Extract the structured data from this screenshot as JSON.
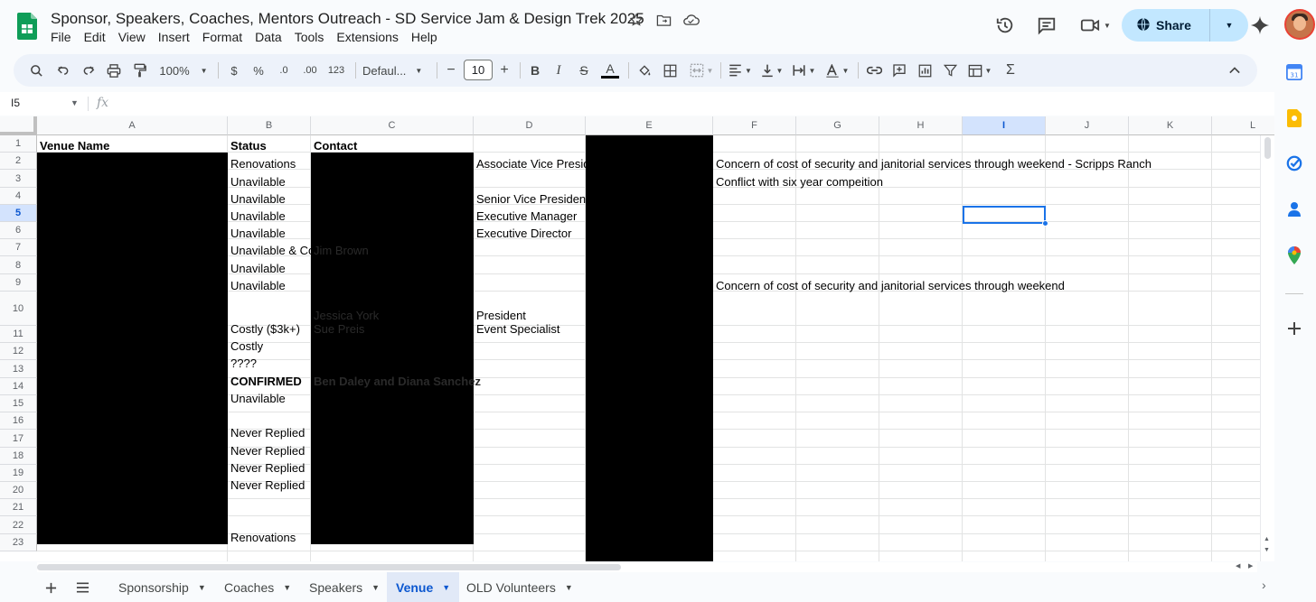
{
  "doc": {
    "title": "Sponsor, Speakers, Coaches, Mentors Outreach - SD Service Jam & Design Trek 2025"
  },
  "menu": [
    "File",
    "Edit",
    "View",
    "Insert",
    "Format",
    "Data",
    "Tools",
    "Extensions",
    "Help"
  ],
  "top_right": {
    "share_label": "Share",
    "icons": [
      "history-icon",
      "comment-icon",
      "video-call-icon",
      "gemini-icon"
    ]
  },
  "toolbar": {
    "zoom": "100%",
    "currency": "$",
    "percent": "%",
    "decrease_decimal": ".0",
    "increase_decimal": ".00",
    "number_format": "123",
    "font": "Defaul...",
    "font_size": "10",
    "minus": "−",
    "plus": "+",
    "bold": "B",
    "italic": "I",
    "strike": "S",
    "text_color": "A",
    "sigma": "Σ"
  },
  "formula": {
    "cell_ref": "I5",
    "fx": "fx"
  },
  "columns": [
    "A",
    "B",
    "C",
    "D",
    "E",
    "F",
    "G",
    "H",
    "I",
    "J",
    "K",
    "L"
  ],
  "selected_column": "I",
  "rows": [
    "1",
    "2",
    "3",
    "4",
    "5",
    "6",
    "7",
    "8",
    "9",
    "10",
    "11",
    "12",
    "13",
    "14",
    "15",
    "16",
    "17",
    "18",
    "19",
    "20",
    "21",
    "22",
    "23"
  ],
  "selected_row": "5",
  "cells": {
    "a1": "Venue Name",
    "b1": "Status",
    "c1": "Contact",
    "b2": "Renovations",
    "d2": "Associate Vice Preside",
    "f2": "Concern of cost of security and janitorial services through weekend - Scripps Ranch",
    "b3": "Unavilable",
    "f3": "Conflict with six year compeition",
    "b4": "Unavilable",
    "d4": "Senior Vice President",
    "b5": "Unavilable",
    "d5": "Executive Manager",
    "b6": "Unavilable",
    "d6": "Executive Director",
    "b7": "Unavilable & Co",
    "c7": "Jim Brown",
    "b8": "Unavilable",
    "b9": "Unavilable",
    "f9": "Concern of cost of security and janitorial services through weekend",
    "c10": "Jessica York\nSue Preis",
    "b10": "Costly ($3k+)",
    "d10": "President\nEvent Specialist",
    "b11": "Costly",
    "b12": "????",
    "b13": "CONFIRMED",
    "c13": "Ben Daley and Diana Sanchez",
    "b14": "Unavilable",
    "b16": "Never Replied",
    "b17": "Never Replied",
    "b18": "Never Replied",
    "b19": "Never Replied",
    "b22": "Renovations"
  },
  "sheets": [
    {
      "label": "Sponsorship",
      "active": false
    },
    {
      "label": "Coaches",
      "active": false
    },
    {
      "label": "Speakers",
      "active": false
    },
    {
      "label": "Venue",
      "active": true
    },
    {
      "label": "OLD Volunteers",
      "active": false
    }
  ],
  "side_panel_icons": [
    "calendar-icon",
    "keep-icon",
    "tasks-icon",
    "contacts-icon",
    "maps-icon",
    "add-icon"
  ],
  "colors": {
    "accent": "#1a73e8",
    "share_bg": "#c2e7ff",
    "toolbar_bg": "#edf2fa",
    "sheets_green": "#0f9d58"
  }
}
